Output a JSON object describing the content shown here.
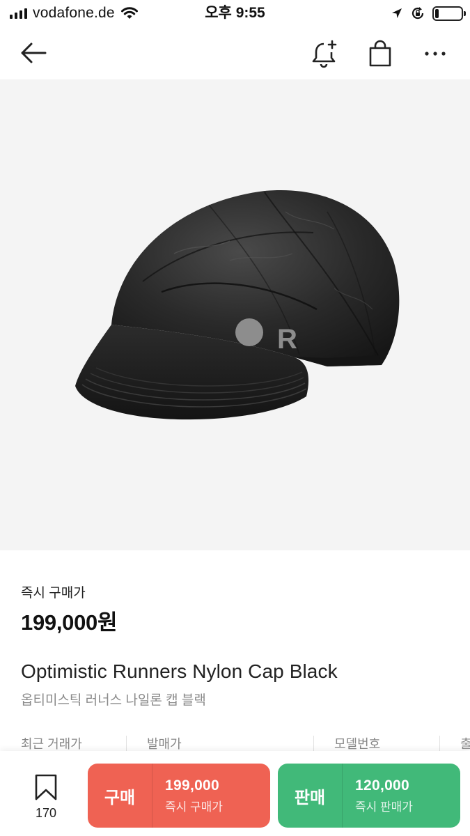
{
  "status_bar": {
    "carrier": "vodafone.de",
    "time": "오후 9:55",
    "battery_level": 0.15
  },
  "nav": {
    "icons": [
      "back-arrow-icon",
      "bell-plus-icon",
      "shopping-bag-icon",
      "more-icon"
    ]
  },
  "product": {
    "image": "black-nylon-cap-photo",
    "logo_text": "R",
    "price_label": "즉시 구매가",
    "price": "199,000원",
    "name_en": "Optimistic Runners Nylon Cap Black",
    "name_ko": "옵티미스틱 러너스 나일론 캡 블랙"
  },
  "specs": {
    "headers": [
      "최근 거래가",
      "발매가",
      "모델번호",
      "출"
    ]
  },
  "bottom_bar": {
    "wish_count": "170",
    "buy": {
      "label": "구매",
      "price": "199,000",
      "sub": "즉시 구매가",
      "color": "#ef6253"
    },
    "sell": {
      "label": "판매",
      "price": "120,000",
      "sub": "즉시 판매가",
      "color": "#41b979"
    }
  }
}
